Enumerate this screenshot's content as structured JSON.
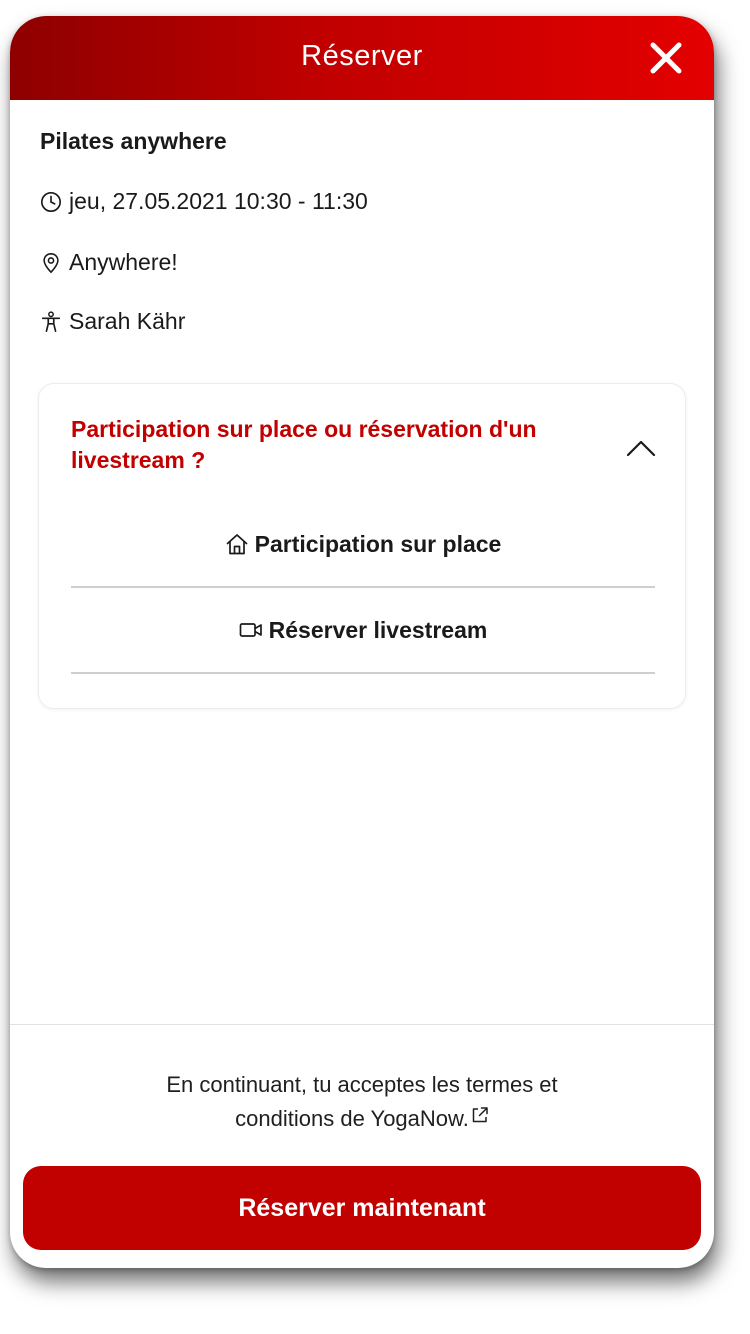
{
  "header": {
    "title": "Réserver",
    "close_icon": "close-icon"
  },
  "class_info": {
    "title": "Pilates anywhere",
    "datetime": "jeu, 27.05.2021 10:30 - 11:30",
    "location": "Anywhere!",
    "teacher": "Sarah Kähr",
    "icons": [
      "clock-icon",
      "location-pin-icon",
      "person-icon"
    ]
  },
  "participation": {
    "question": "Participation sur place ou réservation d'un livestream ?",
    "expanded": true,
    "options": [
      {
        "icon": "home-icon",
        "label": "Participation sur place"
      },
      {
        "icon": "video-camera-icon",
        "label": "Réserver livestream"
      }
    ]
  },
  "footer": {
    "terms_line1": "En continuant, tu acceptes les termes et",
    "terms_line2": "conditions de YogaNow.",
    "book_button": "Réserver maintenant"
  },
  "colors": {
    "accent": "#c10000",
    "header_gradient_start": "#8e0000",
    "header_gradient_end": "#e30000",
    "text": "#1a1a1a"
  }
}
